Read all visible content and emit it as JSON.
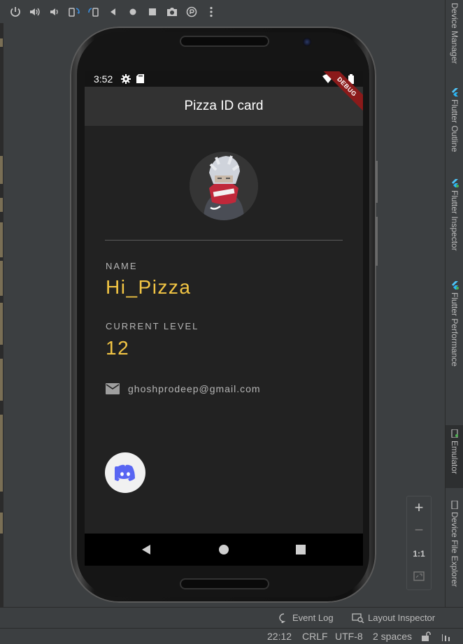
{
  "toolbar": {
    "icons": [
      "power-icon",
      "volume-up-icon",
      "volume-down-icon",
      "rotate-left-icon",
      "rotate-right-icon",
      "back-icon",
      "home-icon",
      "overview-icon",
      "camera-icon",
      "snapshot-icon",
      "more-icon"
    ]
  },
  "right_tabs": [
    {
      "label": "Device Manager"
    },
    {
      "label": "Flutter Outline"
    },
    {
      "label": "Flutter Inspector"
    },
    {
      "label": "Flutter Performance"
    },
    {
      "label": "Emulator"
    },
    {
      "label": "Device File Explorer"
    }
  ],
  "status_bar": {
    "time": "3:52"
  },
  "app": {
    "title": "Pizza ID card",
    "debug_banner": "DEBUG",
    "name_label": "NAME",
    "name_value": "Hi_Pizza",
    "level_label": "CURRENT LEVEL",
    "level_value": "12",
    "email": "ghoshprodeep@gmail.com"
  },
  "zoom_controls": {
    "plus": "+",
    "minus": "−",
    "one_to_one": "1:1"
  },
  "bottom_toolbar": {
    "event_log": "Event Log",
    "layout_inspector": "Layout Inspector"
  },
  "status_line": {
    "position": "22:12",
    "line_sep": "CRLF",
    "encoding": "UTF-8",
    "indent": "2 spaces"
  },
  "colors": {
    "accent_yellow": "#f2c544",
    "discord_blue": "#5865f2",
    "debug_red": "#8b1a1a"
  }
}
